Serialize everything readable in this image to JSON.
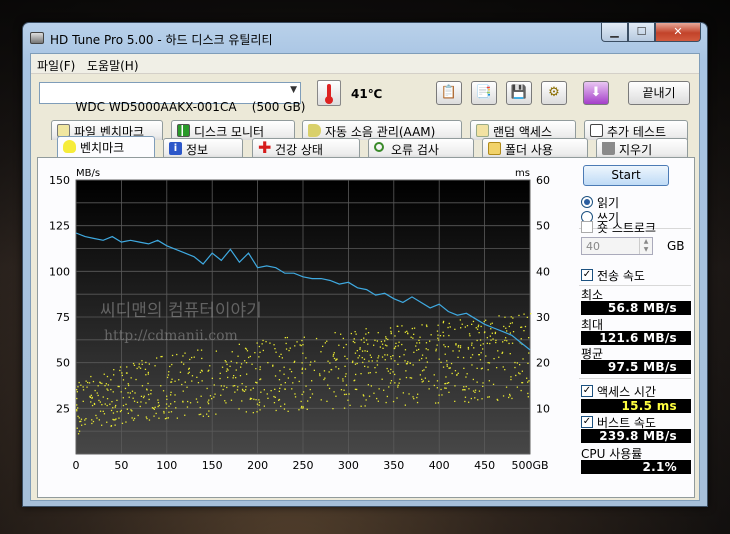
{
  "window": {
    "title": "HD Tune Pro 5.00 - 하드 디스크 유틸리티"
  },
  "menu": [
    "파일(F)",
    "도움말(H)"
  ],
  "toolbar": {
    "drive": "WDC WD5000AAKX-001CA    (500 GB)",
    "temperature": "41℃",
    "exit_label": "끝내기",
    "buttons": [
      "copy-text-icon",
      "copy-image-icon",
      "save-icon",
      "options-icon",
      "down-arrow-icon"
    ]
  },
  "tabs_top": [
    {
      "label": "파일 벤치마크",
      "icon": "file-benchmark-icon"
    },
    {
      "label": "디스크 모니터",
      "icon": "disk-monitor-icon"
    },
    {
      "label": "자동 소음 관리(AAM)",
      "icon": "speaker-icon"
    },
    {
      "label": "랜덤 액세스",
      "icon": "random-access-icon"
    },
    {
      "label": "추가 테스트",
      "icon": "extra-tests-icon"
    }
  ],
  "tabs_bottom": [
    {
      "label": "벤치마크",
      "icon": "bulb-icon"
    },
    {
      "label": "정보",
      "icon": "info-icon"
    },
    {
      "label": "건강 상태",
      "icon": "health-cross-icon"
    },
    {
      "label": "오류 검사",
      "icon": "magnifier-icon"
    },
    {
      "label": "폴더 사용",
      "icon": "folder-icon"
    },
    {
      "label": "지우기",
      "icon": "trash-icon"
    }
  ],
  "colors": {
    "transfer_line": "#3fa9e0",
    "access_dots": "#e8e832",
    "plot_bg_top": "#000000",
    "plot_bg_bottom": "#474747"
  },
  "watermark": {
    "line1": "씨디맨의 컴퓨터이야기",
    "line2": "http://cdmanii.com"
  },
  "side": {
    "start_label": "Start",
    "read_label": "읽기",
    "write_label": "쓰기",
    "short_stroke_label": "숏 스트로크",
    "short_stroke_value": "40",
    "gb_label": "GB",
    "transfer_label": "전송 속도",
    "min_label": "최소",
    "min_value": "56.8 MB/s",
    "max_label": "최대",
    "max_value": "121.6 MB/s",
    "avg_label": "평균",
    "avg_value": "97.5 MB/s",
    "access_label": "액세스 시간",
    "access_value": "15.5 ms",
    "burst_label": "버스트 속도",
    "burst_value": "239.8 MB/s",
    "cpu_label": "CPU 사용률",
    "cpu_value": "2.1%"
  },
  "chart_data": {
    "type": "line",
    "left_unit": "MB/s",
    "right_unit": "ms",
    "x_ticks": [
      "0",
      "50",
      "100",
      "150",
      "200",
      "250",
      "300",
      "350",
      "400",
      "450",
      "500GB"
    ],
    "y_left_ticks": [
      "25",
      "50",
      "75",
      "100",
      "125",
      "150"
    ],
    "y_right_ticks": [
      "10",
      "20",
      "30",
      "40",
      "50",
      "60"
    ],
    "xlim": [
      0,
      500
    ],
    "ylim_left": [
      0,
      150
    ],
    "ylim_right": [
      0,
      60
    ],
    "grid": true,
    "series": [
      {
        "type": "line",
        "axis": "left",
        "x": [
          0,
          10,
          20,
          30,
          40,
          50,
          60,
          70,
          80,
          90,
          100,
          110,
          120,
          130,
          140,
          150,
          160,
          170,
          180,
          190,
          200,
          210,
          220,
          230,
          240,
          250,
          260,
          270,
          280,
          290,
          300,
          310,
          320,
          330,
          340,
          350,
          360,
          370,
          380,
          390,
          400,
          410,
          420,
          430,
          440,
          450,
          460,
          470,
          480,
          490,
          500
        ],
        "y": [
          121,
          119,
          118,
          117,
          119,
          116,
          117,
          116,
          115,
          117,
          114,
          112,
          110,
          108,
          104,
          110,
          106,
          112,
          105,
          110,
          102,
          103,
          102,
          99,
          99,
          97,
          96,
          96,
          95,
          93,
          94,
          91,
          90,
          87,
          88,
          85,
          83,
          86,
          83,
          80,
          82,
          78,
          76,
          77,
          74,
          71,
          69,
          67,
          65,
          61,
          57
        ]
      },
      {
        "type": "scatter",
        "axis": "right",
        "description_range": "access time scatter band",
        "x_range": [
          0,
          500
        ],
        "y_low_start": 4,
        "y_high_start": 15,
        "y_low_end": 12,
        "y_high_end": 31
      }
    ]
  }
}
